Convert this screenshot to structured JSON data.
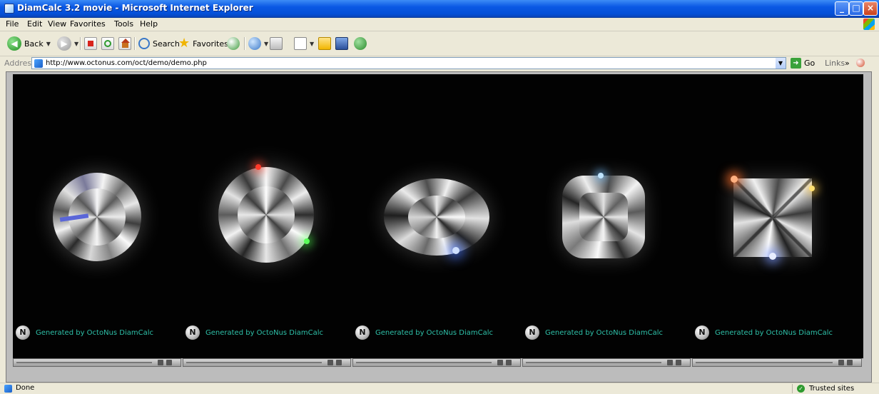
{
  "window": {
    "title": "DiamCalc 3.2 movie - Microsoft Internet Explorer",
    "buttons": {
      "minimize": "_",
      "maximize": "□",
      "close": "×"
    }
  },
  "menubar": {
    "items": [
      "File",
      "Edit",
      "View",
      "Favorites",
      "Tools",
      "Help"
    ]
  },
  "toolbar": {
    "back_label": "Back",
    "search_label": "Search",
    "favorites_label": "Favorites"
  },
  "addressbar": {
    "label": "Address",
    "url": "http://www.octonus.com/oct/demo/demo.php",
    "go_label": "Go",
    "links_label": "Links"
  },
  "content": {
    "panels": [
      {
        "credit": "Generated by OctoNus DiamCalc",
        "shape": "round-brilliant"
      },
      {
        "credit": "Generated by OctoNus DiamCalc",
        "shape": "round-brilliant"
      },
      {
        "credit": "Generated by OctoNus DiamCalc",
        "shape": "oval"
      },
      {
        "credit": "Generated by OctoNus DiamCalc",
        "shape": "cushion"
      },
      {
        "credit": "Generated by OctoNus DiamCalc",
        "shape": "princess"
      }
    ]
  },
  "statusbar": {
    "status": "Done",
    "zone": "Trusted sites"
  },
  "colors": {
    "title_bar": "#0a58e4",
    "stage_background": "#020202",
    "credit_text": "#2ec0a8"
  }
}
